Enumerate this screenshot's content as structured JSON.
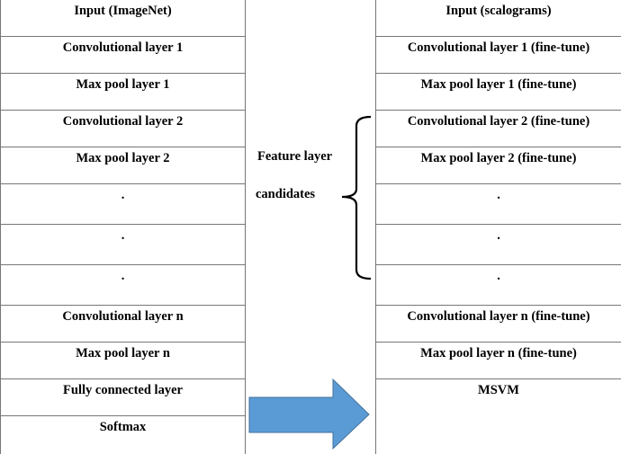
{
  "left_column": {
    "rows": [
      "Input (ImageNet)",
      "Convolutional layer 1",
      "Max pool layer 1",
      "Convolutional layer 2",
      "Max pool layer 2",
      ".",
      ".",
      ".",
      "Convolutional layer n",
      "Max pool layer n",
      "Fully connected layer",
      "Softmax"
    ]
  },
  "right_column": {
    "rows": [
      "Input (scalograms)",
      "Convolutional layer 1 (fine-tune)",
      "Max pool layer 1 (fine-tune)",
      "Convolutional layer 2 (fine-tune)",
      "Max pool layer 2 (fine-tune)",
      ".",
      ".",
      ".",
      "Convolutional layer n (fine-tune)",
      "Max pool layer n (fine-tune)",
      "MSVM"
    ]
  },
  "annotation": {
    "line1": "Feature layer",
    "line2": "candidates"
  },
  "colors": {
    "arrow_fill": "#5b9bd5",
    "arrow_stroke": "#41719c",
    "border": "#777777"
  }
}
